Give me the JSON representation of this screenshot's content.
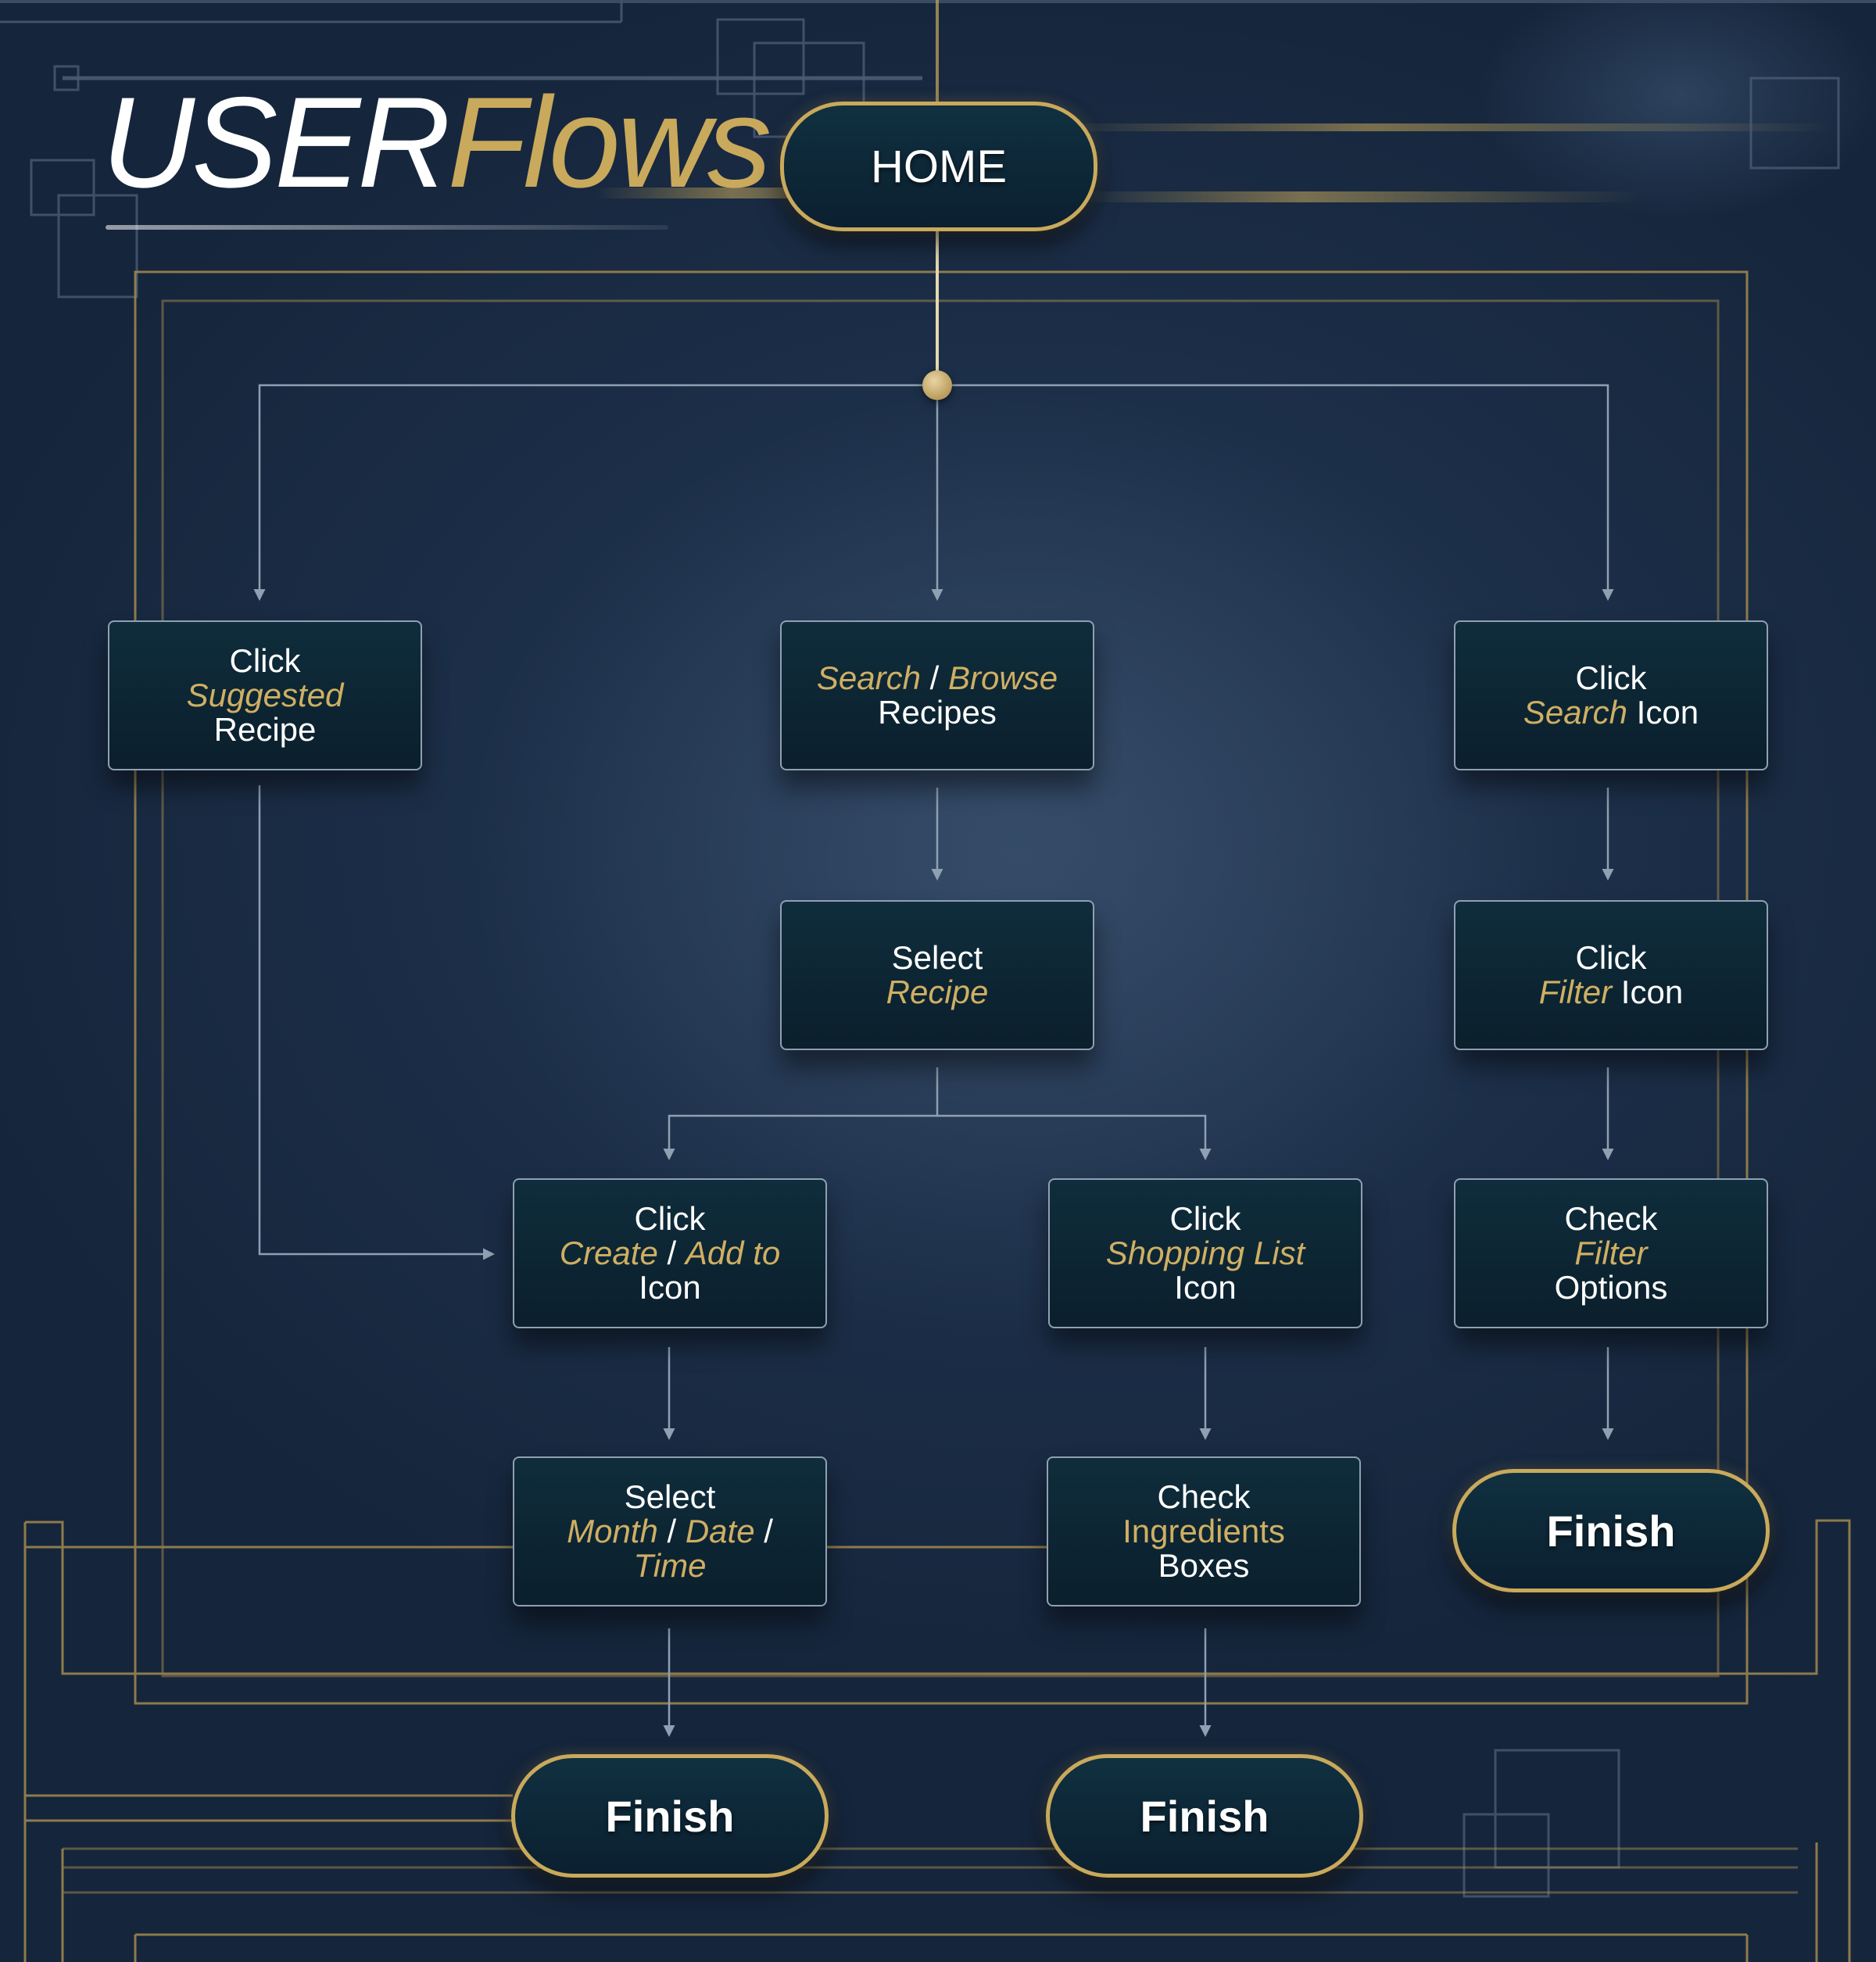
{
  "title": {
    "part1": "USER",
    "part2": "Flows"
  },
  "colors": {
    "gold": "#c9a95b",
    "background": "#1d304a",
    "box": "#0f2d3c",
    "line": "#8fa0b2"
  },
  "home": {
    "label": "HOME"
  },
  "nodes": {
    "suggested": {
      "l1": "Click",
      "l2": "Suggested",
      "l3": "Recipe"
    },
    "search_browse": {
      "a": "Search",
      "sep": " / ",
      "b": "Browse",
      "l2": "Recipes"
    },
    "search_icon": {
      "l1": "Click",
      "g": "Search",
      "rest": " Icon"
    },
    "select_recipe": {
      "l1": "Select",
      "l2": "Recipe"
    },
    "filter_icon": {
      "l1": "Click",
      "g": "Filter",
      "rest": " Icon"
    },
    "create_add": {
      "l1": "Click",
      "a": "Create",
      "sep": " / ",
      "b": "Add to",
      "l3": "Icon"
    },
    "shopping_list": {
      "l1": "Click",
      "l2": "Shopping List",
      "l3": "Icon"
    },
    "filter_options": {
      "l1": "Check",
      "l2": "Filter",
      "l3": "Options"
    },
    "month_date": {
      "l1": "Select",
      "a": "Month",
      "sep1": " / ",
      "b": "Date",
      "sep2": " /",
      "l3": "Time"
    },
    "ingredients": {
      "l1": "Check",
      "l2": "Ingredients",
      "l3": "Boxes"
    }
  },
  "finish": {
    "label": "Finish"
  }
}
